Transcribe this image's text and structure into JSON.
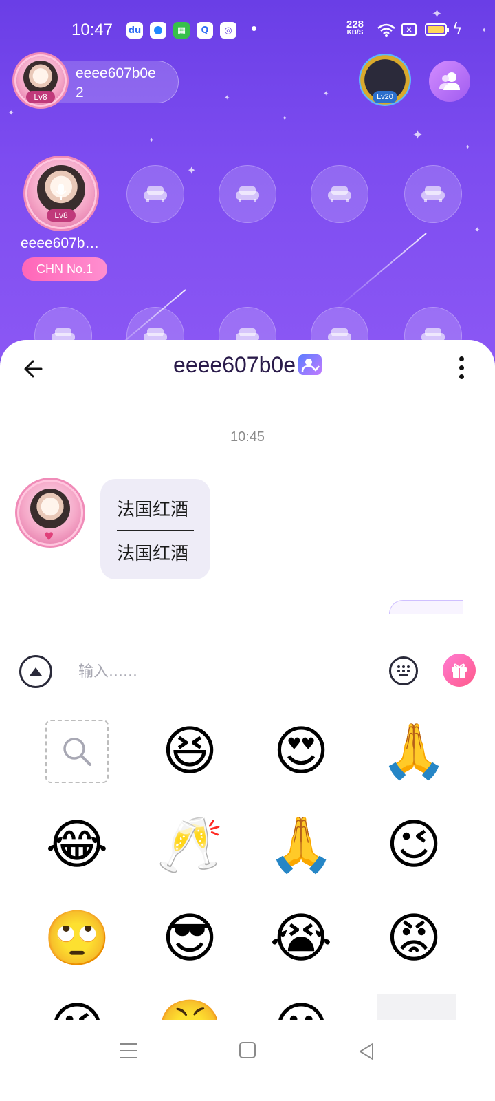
{
  "status_bar": {
    "time": "10:47",
    "net_speed_value": "228",
    "net_speed_unit": "KB/S",
    "battery_color": "#ffd75a",
    "app_icons": [
      "baidu-icon",
      "circle-app-icon",
      "green-shop-icon",
      "q-app-icon",
      "target-app-icon"
    ]
  },
  "room": {
    "owner_name": "eeee607b0e",
    "owner_count": "2",
    "owner_level": "Lv8",
    "vip_level": "Lv20",
    "seat_user_name": "eeee607b…",
    "seat_user_level": "Lv8",
    "seat_badge": "CHN No.1"
  },
  "chat": {
    "title": "eeee607b0e",
    "timestamp": "10:45",
    "message_line_1": "法国红酒",
    "message_line_2": "法国红酒",
    "input_placeholder": "输入......"
  },
  "emoji_panel": {
    "search_icon": "search-icon",
    "emojis": [
      "😆",
      "😍",
      "🙏",
      "😂",
      "🥂",
      "🙏",
      "😉",
      "😎",
      "😭",
      "😡"
    ]
  },
  "colors": {
    "accent": "#7b4fe8",
    "bubble": "#eeecf7",
    "badge_pink": "#ff66b8"
  }
}
